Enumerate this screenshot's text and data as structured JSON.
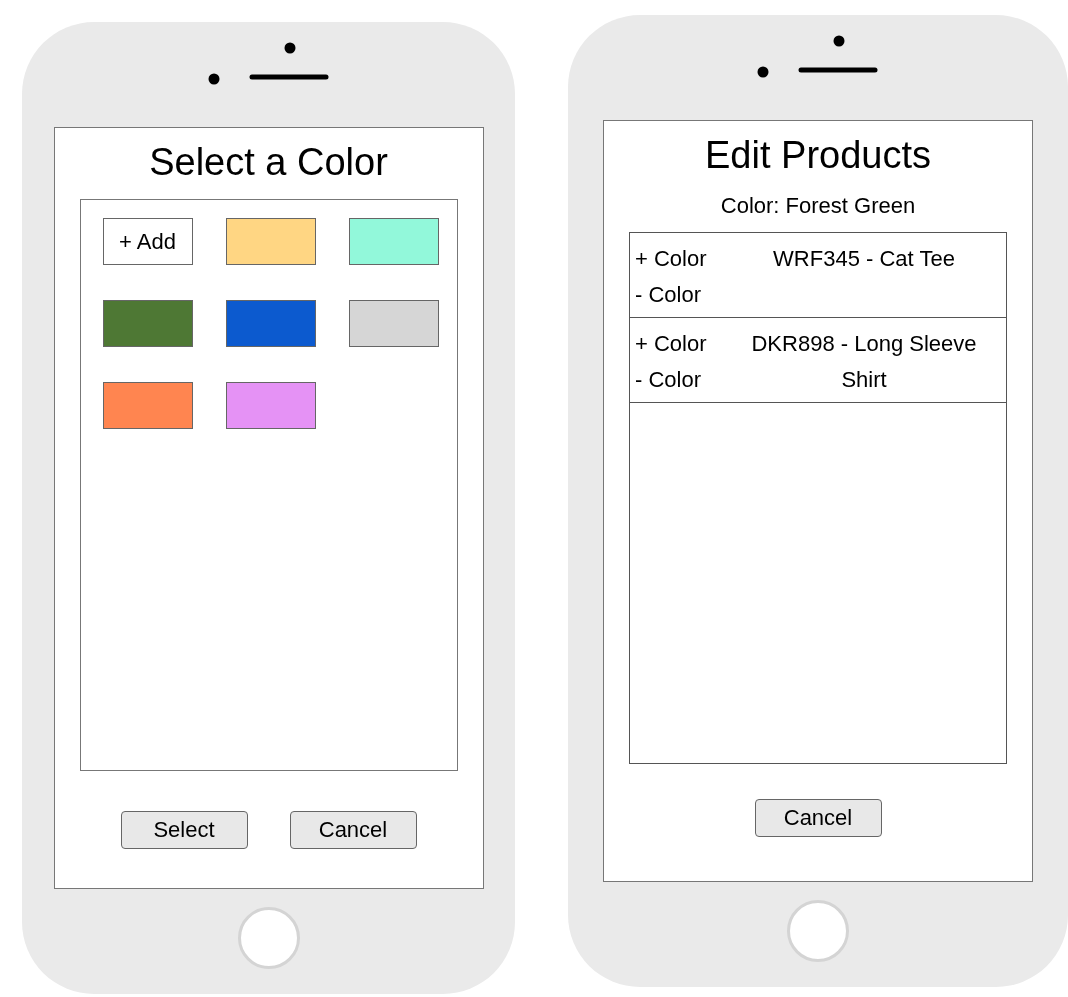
{
  "color_picker": {
    "title": "Select a Color",
    "swatches": [
      {
        "kind": "add",
        "label": "+ Add"
      },
      {
        "kind": "color",
        "color": "#ffd683"
      },
      {
        "kind": "color",
        "color": "#92f8da"
      },
      {
        "kind": "color",
        "color": "#4e7834"
      },
      {
        "kind": "color",
        "color": "#0c5acf"
      },
      {
        "kind": "color",
        "color": "#d6d6d6"
      },
      {
        "kind": "color",
        "color": "#ff8550"
      },
      {
        "kind": "color",
        "color": "#e592f5"
      }
    ],
    "buttons": [
      "Select",
      "Cancel"
    ]
  },
  "edit_products": {
    "title": "Edit Products",
    "subtitle": "Color: Forest Green",
    "products": [
      {
        "add_label": "+ Color",
        "remove_label": "- Color",
        "name": "WRF345 - Cat Tee"
      },
      {
        "add_label": "+ Color",
        "remove_label": "- Color",
        "name": "DKR898 - Long Sleeve Shirt"
      }
    ],
    "buttons": [
      "Cancel"
    ]
  }
}
